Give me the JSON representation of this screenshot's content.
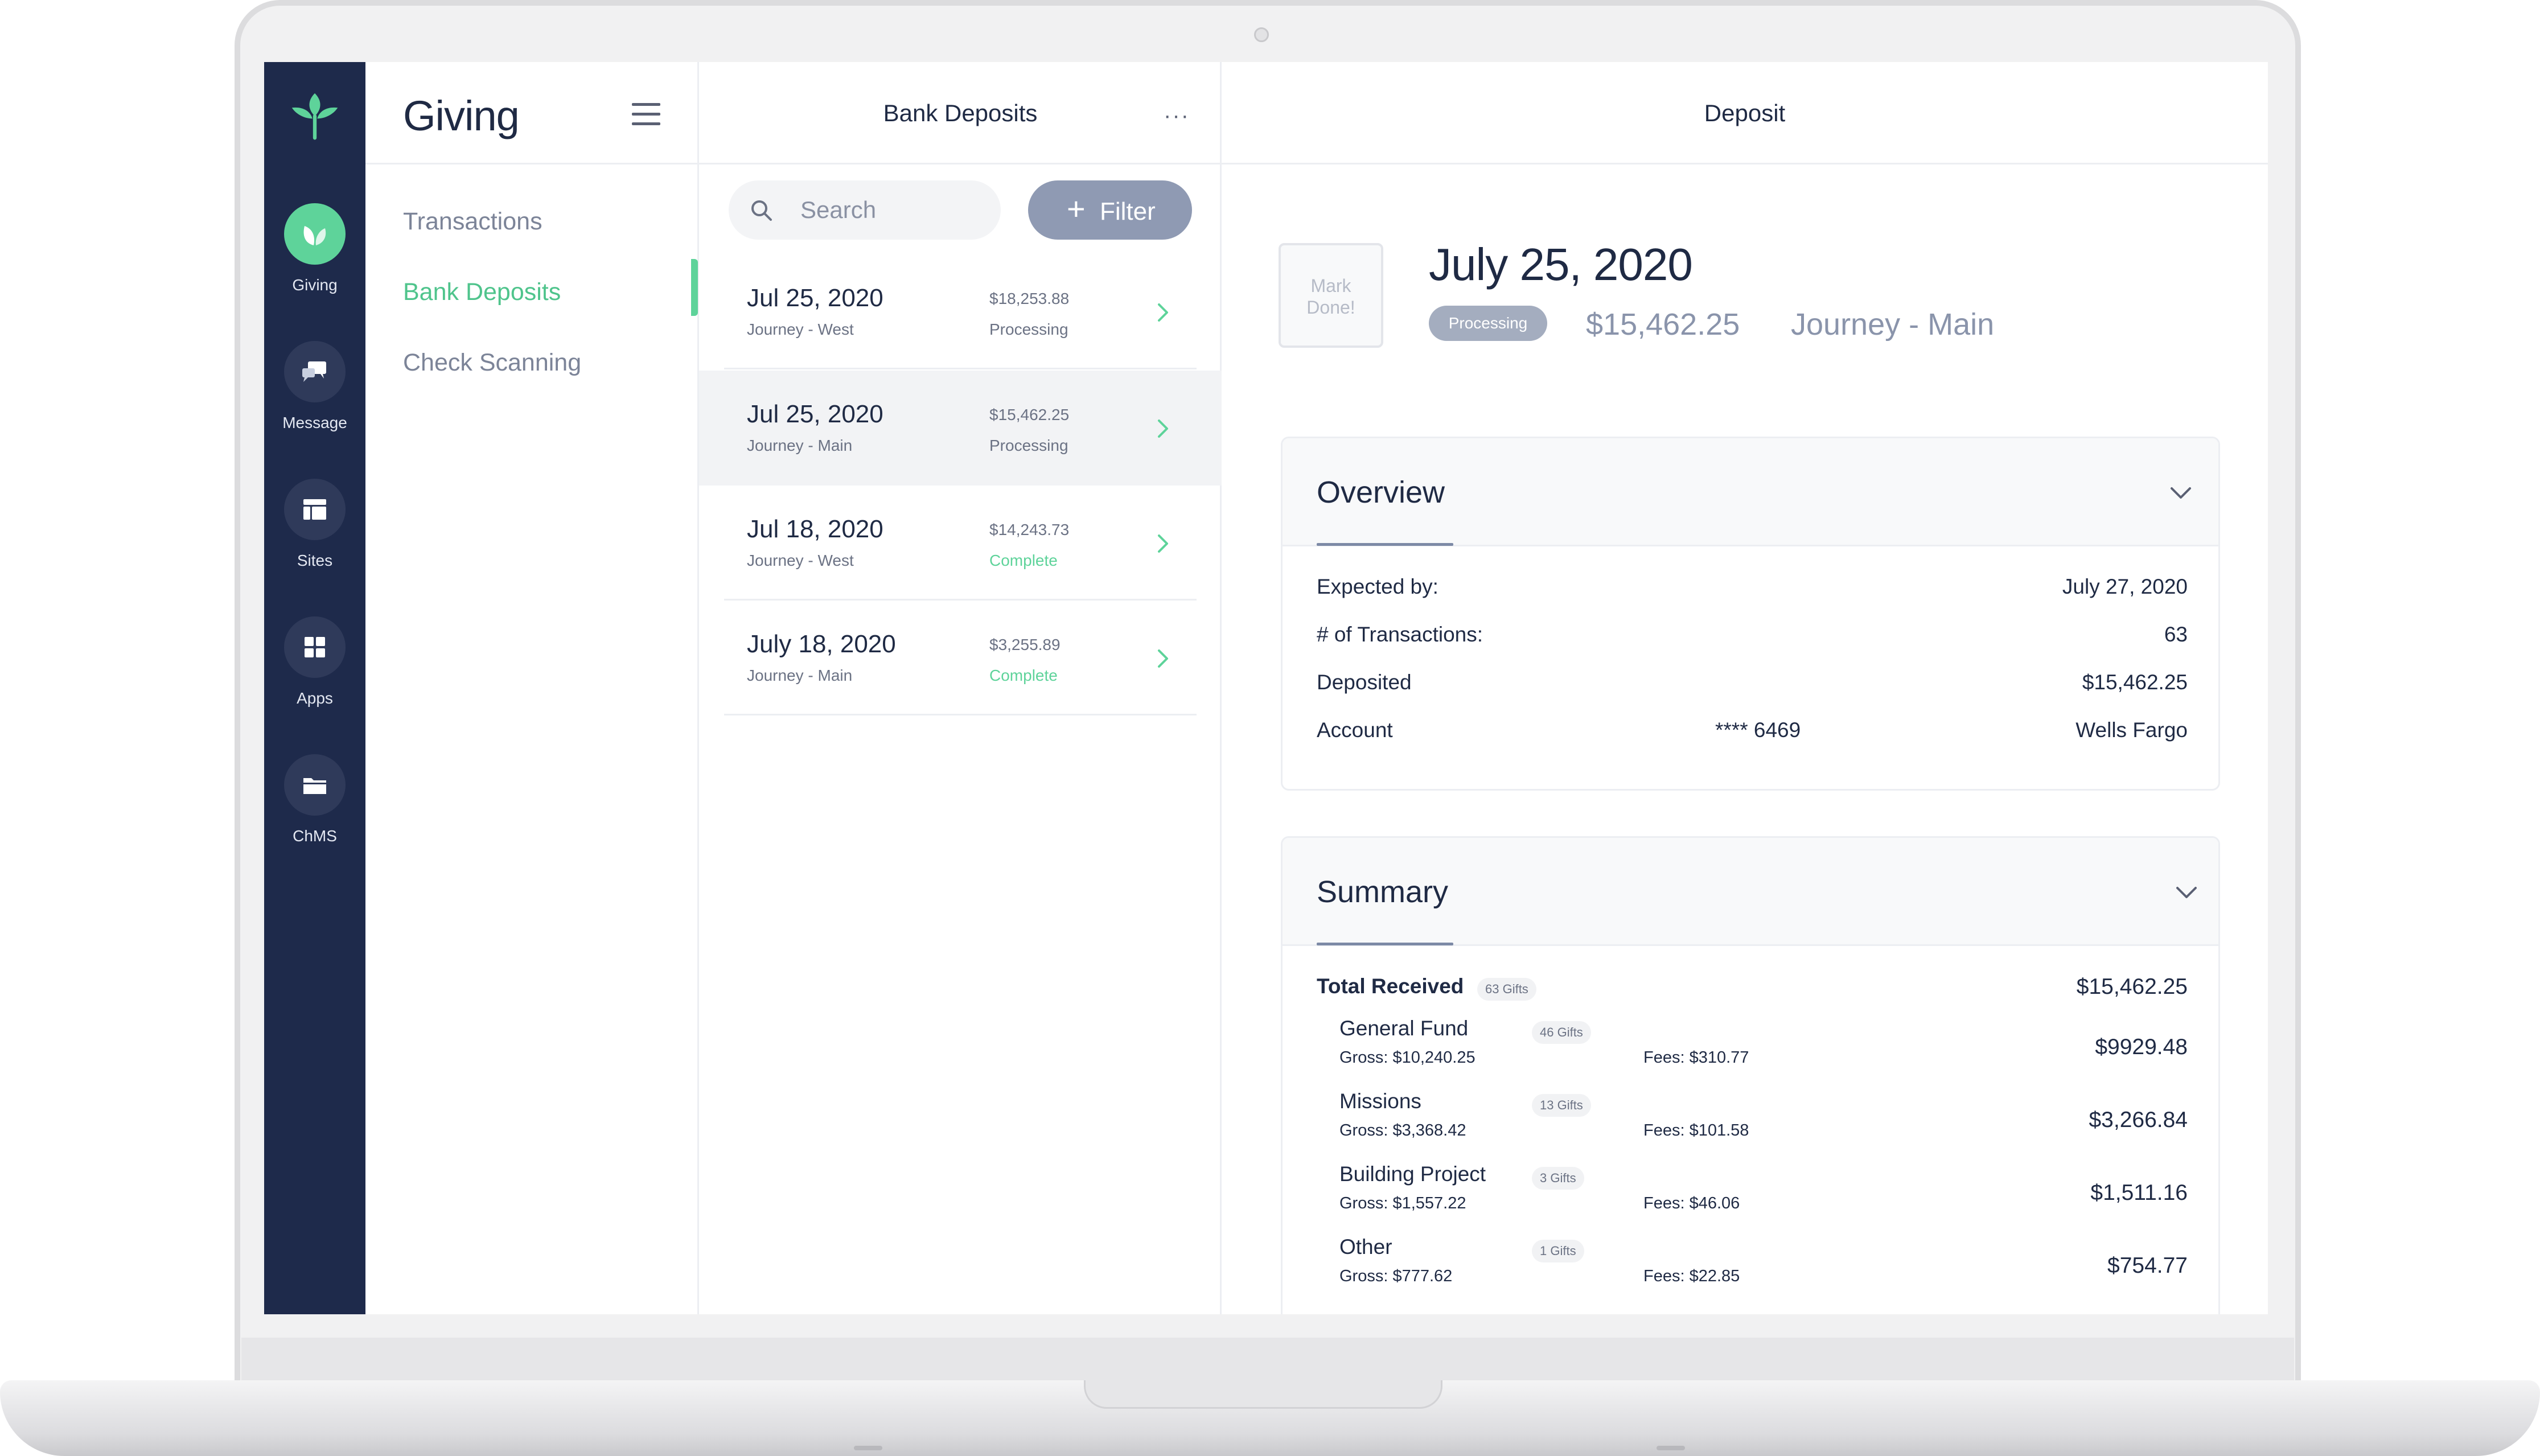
{
  "rail": {
    "items": [
      {
        "label": "Giving",
        "icon": "leaf-icon",
        "active": true
      },
      {
        "label": "Message",
        "icon": "chat-bubbles-icon"
      },
      {
        "label": "Sites",
        "icon": "layout-icon"
      },
      {
        "label": "Apps",
        "icon": "grid-icon"
      },
      {
        "label": "ChMS",
        "icon": "folder-icon"
      }
    ]
  },
  "nav": {
    "title": "Giving",
    "items": [
      {
        "label": "Transactions"
      },
      {
        "label": "Bank Deposits",
        "active": true
      },
      {
        "label": "Check Scanning"
      }
    ]
  },
  "list": {
    "title": "Bank Deposits",
    "more": "···",
    "search_placeholder": "Search",
    "filter_label": "Filter",
    "rows": [
      {
        "date": "Jul 25, 2020",
        "location": "Journey - West",
        "amount": "$18,253.88",
        "status": "Processing"
      },
      {
        "date": "Jul 25, 2020",
        "location": "Journey - Main",
        "amount": "$15,462.25",
        "status": "Processing",
        "selected": true
      },
      {
        "date": "Jul 18, 2020",
        "location": "Journey - West",
        "amount": "$14,243.73",
        "status": "Complete"
      },
      {
        "date": "July 18, 2020",
        "location": "Journey - Main",
        "amount": "$3,255.89",
        "status": "Complete"
      }
    ]
  },
  "detail": {
    "title": "Deposit",
    "mark_done_line1": "Mark",
    "mark_done_line2": "Done!",
    "date": "July 25, 2020",
    "status": "Processing",
    "amount": "$15,462.25",
    "campus": "Journey - Main",
    "overview": {
      "title": "Overview",
      "expected_label": "Expected by:",
      "expected_value": "July 27, 2020",
      "transactions_label": "# of Transactions:",
      "transactions_value": "63",
      "deposited_label": "Deposited",
      "deposited_value": "$15,462.25",
      "account_label": "Account",
      "account_number": "**** 6469",
      "account_bank": "Wells Fargo"
    },
    "summary": {
      "title": "Summary",
      "total_label": "Total Received",
      "total_gifts": "63 Gifts",
      "total_value": "$15,462.25",
      "funds": [
        {
          "name": "General Fund",
          "gifts": "46 Gifts",
          "gross": "Gross: $10,240.25",
          "fees": "Fees: $310.77",
          "net": "$9929.48"
        },
        {
          "name": "Missions",
          "gifts": "13 Gifts",
          "gross": "Gross: $3,368.42",
          "fees": "Fees: $101.58",
          "net": "$3,266.84"
        },
        {
          "name": "Building Project",
          "gifts": "3 Gifts",
          "gross": "Gross: $1,557.22",
          "fees": "Fees: $46.06",
          "net": "$1,511.16"
        },
        {
          "name": "Other",
          "gifts": "1 Gifts",
          "gross": "Gross: $777.62",
          "fees": "Fees: $22.85",
          "net": "$754.77"
        }
      ]
    }
  },
  "colors": {
    "rail_bg": "#1e2a4b",
    "accent_green": "#5ed39a",
    "pill_gray": "#a4adbf",
    "filter_bg": "#8f9ab3"
  }
}
